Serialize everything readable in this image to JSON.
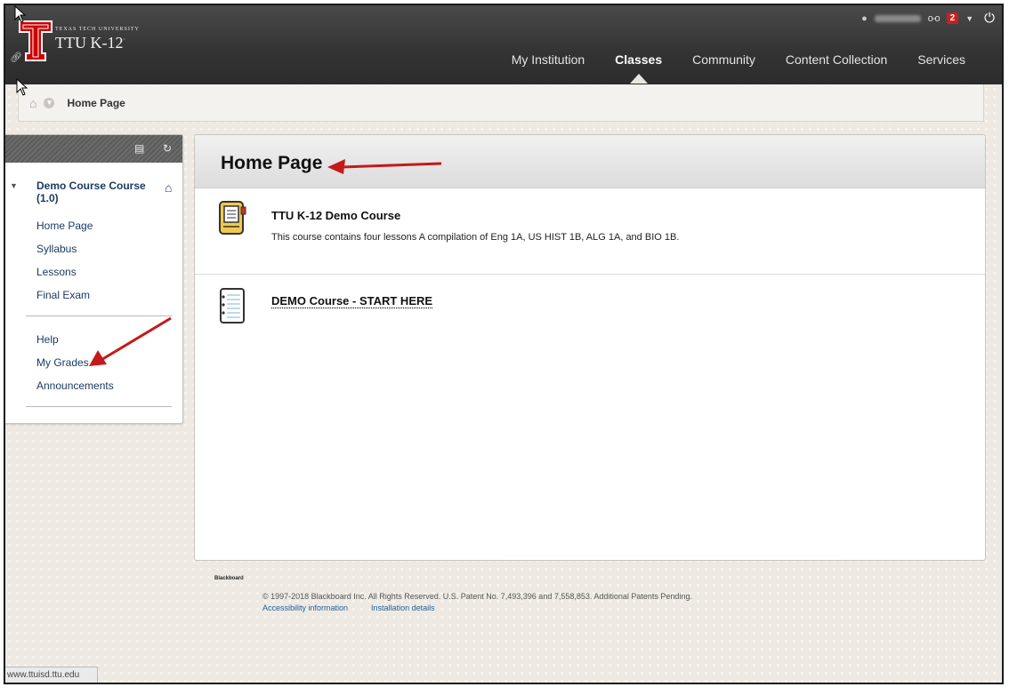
{
  "header": {
    "brand_small": "TEXAS TECH UNIVERSITY",
    "brand_big": "TTU K-12",
    "brand_mark": "·",
    "nav": [
      {
        "label": "My Institution",
        "active": false
      },
      {
        "label": "Classes",
        "active": true
      },
      {
        "label": "Community",
        "active": false
      },
      {
        "label": "Content Collection",
        "active": false
      },
      {
        "label": "Services",
        "active": false
      }
    ],
    "notification_count": "2"
  },
  "breadcrumb": {
    "current": "Home Page"
  },
  "sidebar": {
    "course_name": "Demo Course Course (1.0)",
    "items_group1": [
      "Home Page",
      "Syllabus",
      "Lessons",
      "Final Exam"
    ],
    "items_group2": [
      "Help",
      "My Grades",
      "Announcements"
    ]
  },
  "content": {
    "title": "Home Page",
    "items": [
      {
        "title": "TTU K-12 Demo Course",
        "description": "This course contains four lessons A compilation of Eng 1A, US HIST 1B, ALG 1A, and BIO 1B."
      },
      {
        "title": "DEMO Course - START HERE",
        "description": ""
      }
    ]
  },
  "footer": {
    "logo": "Blackboard",
    "copyright": "© 1997-2018 Blackboard Inc. All Rights Reserved. U.S. Patent No. 7,493,396 and 7,558,853. Additional Patents Pending.",
    "links": [
      "Accessibility information",
      "Installation details"
    ]
  },
  "status_url": "www.ttuisd.ttu.edu",
  "colors": {
    "topbar": "#333333",
    "brand_red": "#cc0000",
    "link": "#1b3a63",
    "arrow_red": "#c41a1a"
  }
}
